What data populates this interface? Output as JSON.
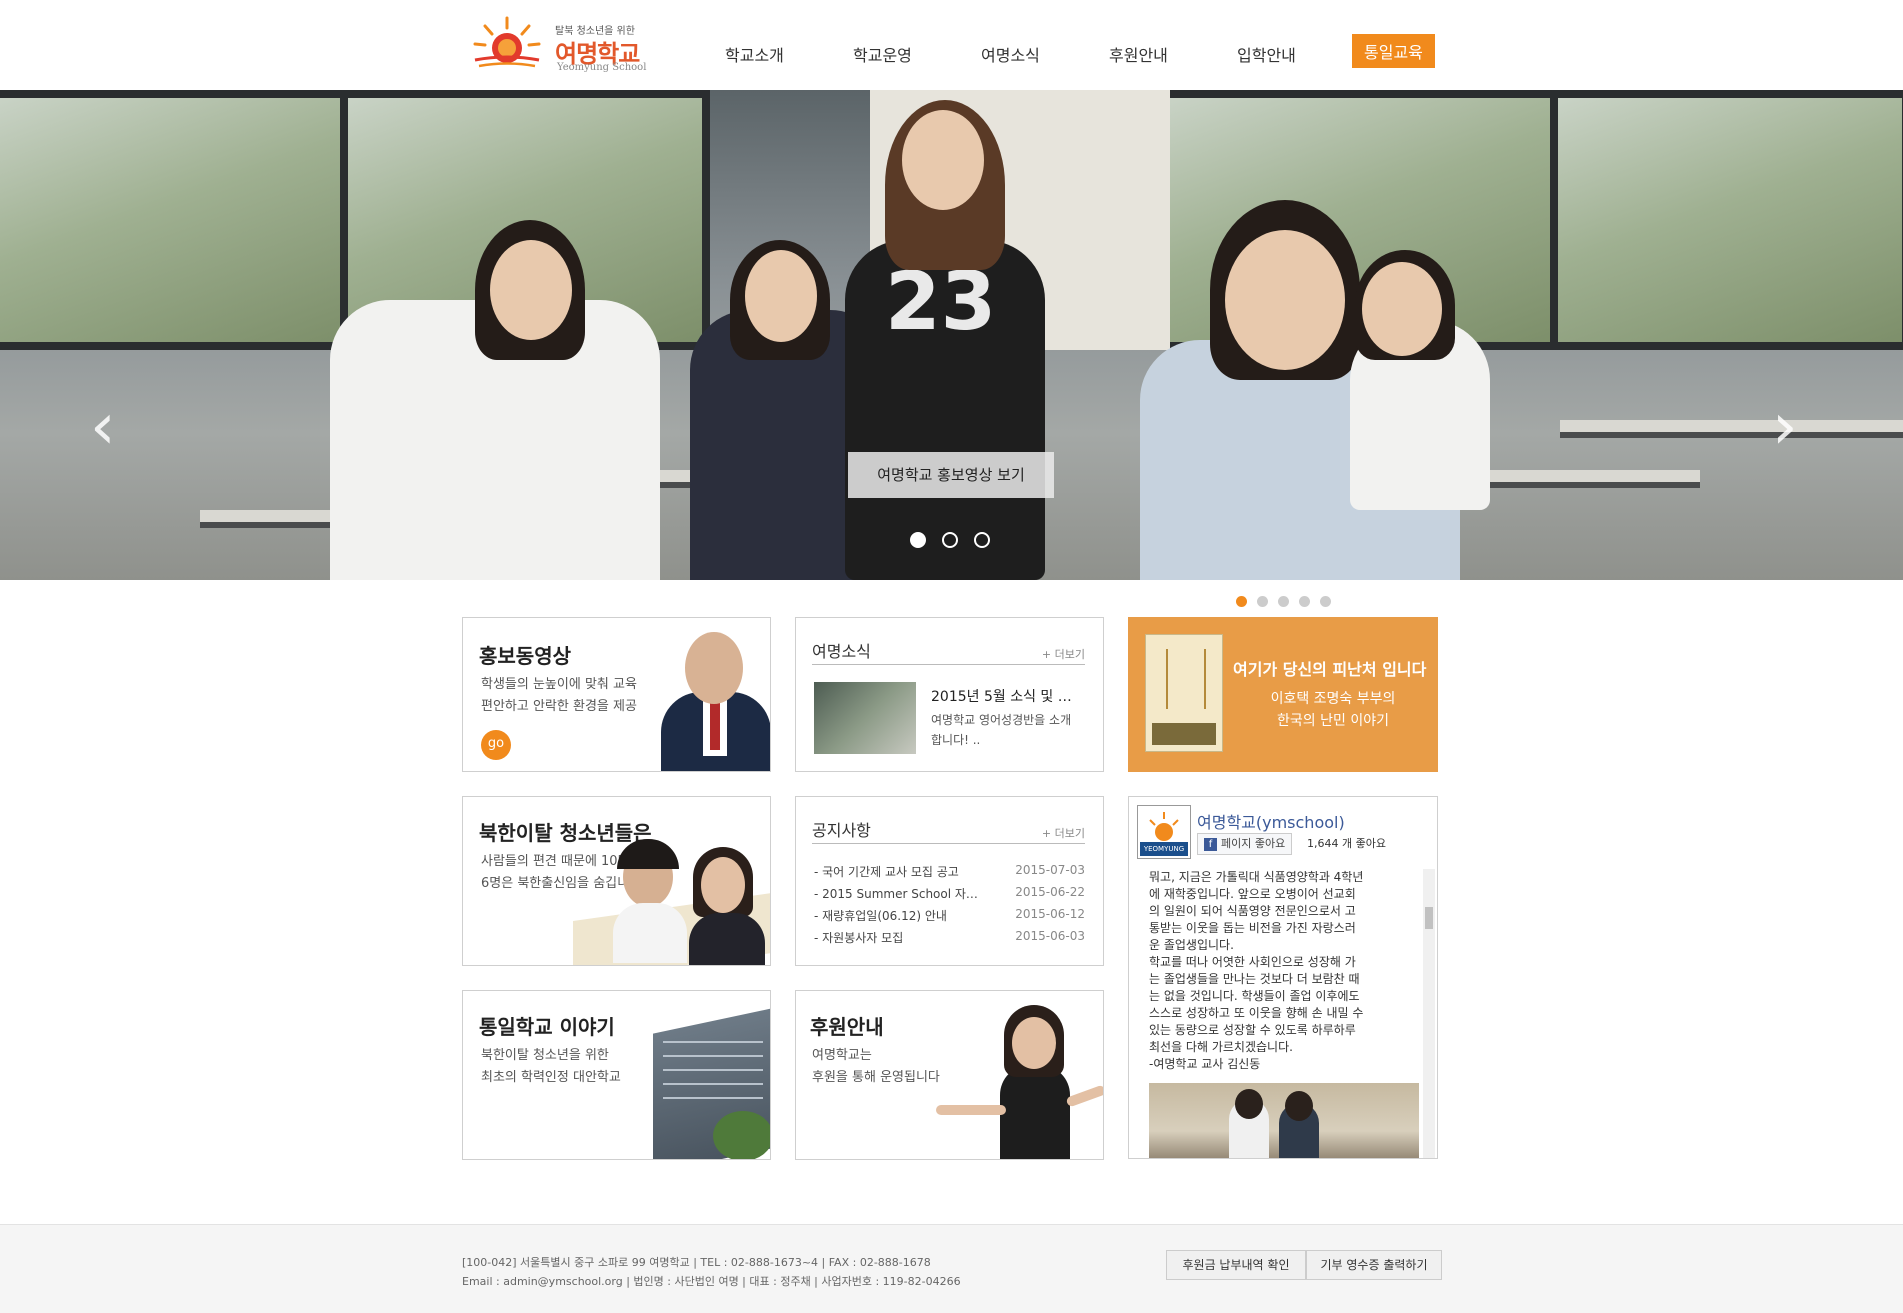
{
  "header": {
    "logo_sub": "탈북 청소년을 위한",
    "logo_main": "여명학교",
    "logo_en": "Yeomyung School",
    "nav": [
      "학교소개",
      "학교운영",
      "여명소식",
      "후원안내",
      "입학안내",
      "통일교육"
    ]
  },
  "hero": {
    "prev_icon": "chevron-left-icon",
    "next_icon": "chevron-right-icon",
    "promo_label": "여명학교 홍보영상 보기",
    "dots_count": 3,
    "active_dot": 1
  },
  "sub_dots": {
    "count": 5,
    "active": 1
  },
  "promo_video": {
    "title": "홍보동영상",
    "desc1": "학생들의 눈높이에 맞춰 교육",
    "desc2": "편안하고 안락한 환경을 제공",
    "go_label": "go"
  },
  "news": {
    "title": "여명소식",
    "more": "+ 더보기",
    "item_title": "2015년 5월 소식 및 …",
    "item_text1": "여명학교 영어성경반을 소개",
    "item_text2": "합니다! .."
  },
  "refuge": {
    "title": "여기가 당신의 피난처 입니다",
    "desc1": "이호택 조명숙 부부의",
    "desc2": "한국의 난민 이야기"
  },
  "nk_youth": {
    "title": "북한이탈 청소년들은",
    "desc1": "사람들의 편견 때문에 10명중",
    "desc2": "6명은 북한출신임을 숨깁니다."
  },
  "notice": {
    "title": "공지사항",
    "more": "+ 더보기",
    "items": [
      {
        "title": "- 국어 기간제 교사 모집 공고",
        "date": "2015-07-03"
      },
      {
        "title": "- 2015 Summer School 자…",
        "date": "2015-06-22"
      },
      {
        "title": "- 재량휴업일(06.12) 안내",
        "date": "2015-06-12"
      },
      {
        "title": "- 자원봉사자 모집",
        "date": "2015-06-03"
      }
    ]
  },
  "fb": {
    "page_name": "여명학교(ymschool)",
    "like_label": "페이지 좋아요",
    "like_count": "1,644 개 좋아요",
    "logo_text": "YEOMYUNG",
    "feed": [
      "뭐고, 지금은 가톨릭대 식품영양학과 4학년",
      "에 재학중입니다. 앞으로 오병이어 선교회",
      "의 일원이 되어 식품영양 전문인으로서 고",
      "통받는 이웃을 돕는 비전을 가진 자랑스러",
      "운 졸업생입니다.",
      "학교를 떠나 어엿한 사회인으로 성장해 가",
      "는 졸업생들을 만나는 것보다 더 보람찬 때",
      "는 없을 것입니다. 학생들이 졸업 이후에도",
      "스스로 성장하고 또 이웃을 향해 손 내밀 수",
      "있는 동량으로 성장할 수 있도록 하루하루",
      "최선을 다해 가르치겠습니다.",
      "-여명학교 교사 김신동"
    ]
  },
  "unification": {
    "title": "통일학교 이야기",
    "desc1": "북한이탈 청소년을 위한",
    "desc2": "최초의 학력인정 대안학교"
  },
  "support": {
    "title": "후원안내",
    "desc1": "여명학교는",
    "desc2": "후원을 통해 운영됩니다"
  },
  "footer": {
    "line1": "[100-042] 서울특별시 중구 소파로 99 여명학교 | TEL : 02-888-1673~4 | FAX : 02-888-1678",
    "line2": "Email : admin@ymschool.org | 법인명 : 사단법인 여명 | 대표 : 정주채 | 사업자번호 : 119-82-04266",
    "btn1": "후원금 납부내역 확인",
    "btn2": "기부 영수증 출력하기"
  },
  "colors": {
    "accent": "#f18a1c",
    "orange_box": "#e89c47",
    "fb_blue": "#3b5998"
  }
}
